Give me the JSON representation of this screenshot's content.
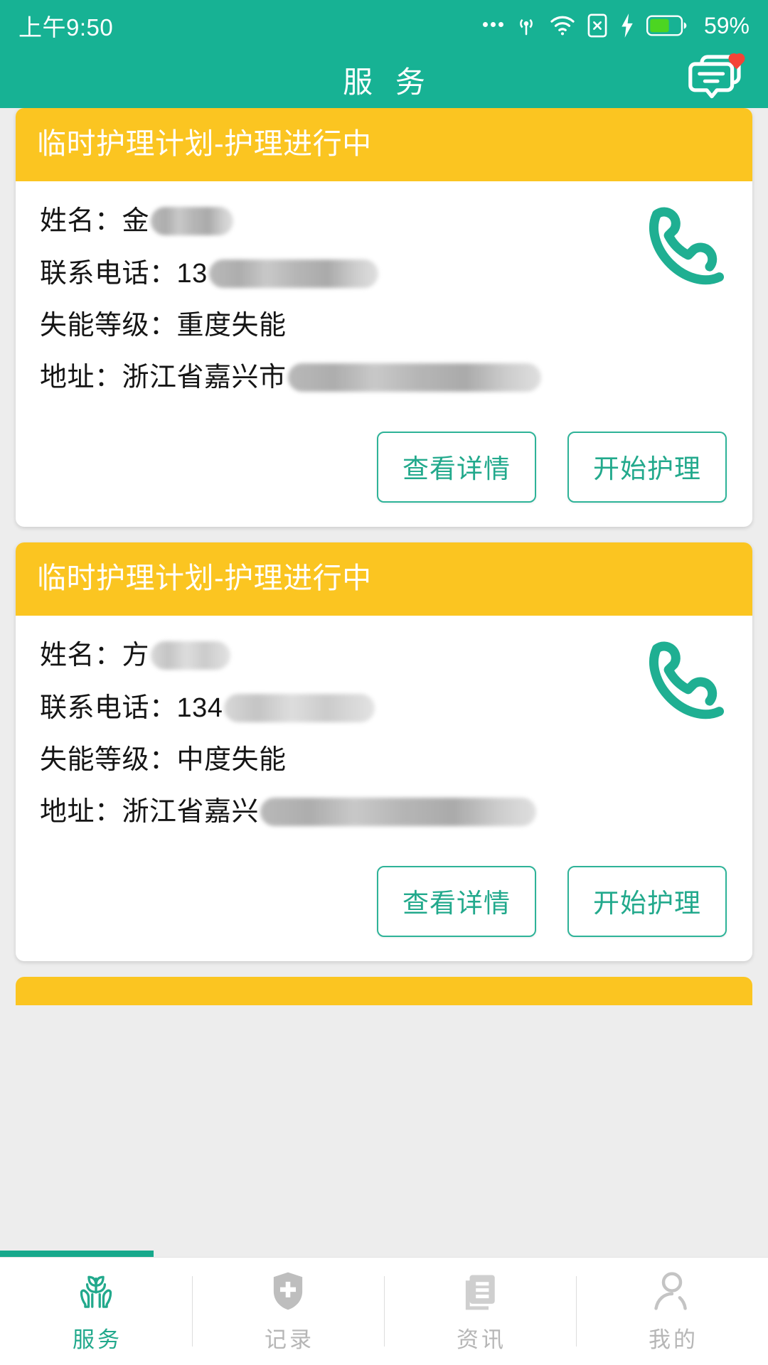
{
  "status_bar": {
    "time": "上午9:50",
    "battery_percent": "59%",
    "icons": [
      "more-dots-icon",
      "location-icon",
      "wifi-icon",
      "sim-card-disabled-icon",
      "charging-bolt-icon",
      "battery-icon"
    ],
    "background_color": "#17B294",
    "text_color": "#FFFFFF"
  },
  "app_bar": {
    "title": "服 务",
    "message_icon": "chat-bubbles-icon",
    "badge_icon": "heart-badge-icon",
    "badge_color": "#F44336",
    "background_color": "#17B294"
  },
  "theme": {
    "accent": "#17B294",
    "card_header": "#FBC521",
    "button_border": "#2EB398",
    "button_text": "#22A98C",
    "page_background": "#EDEDED"
  },
  "labels": {
    "name": "姓名：",
    "phone": "联系电话：",
    "level": "失能等级：",
    "address": "地址："
  },
  "cards": [
    {
      "header": "临时护理计划-护理进行中",
      "name_value": "金",
      "phone_value": "13",
      "level_value": "重度失能",
      "address_value": "浙江省嘉兴市",
      "phone_icon": "phone-handset-icon",
      "buttons": [
        {
          "label": "查看详情",
          "name": "view-details-button"
        },
        {
          "label": "开始护理",
          "name": "start-care-button"
        }
      ]
    },
    {
      "header": "临时护理计划-护理进行中",
      "name_value": "方",
      "phone_value": "134",
      "level_value": "中度失能",
      "address_value": "浙江省嘉兴",
      "phone_icon": "phone-handset-icon",
      "buttons": [
        {
          "label": "查看详情",
          "name": "view-details-button"
        },
        {
          "label": "开始护理",
          "name": "start-care-button"
        }
      ]
    }
  ],
  "tab_bar": {
    "active_index": 0,
    "items": [
      {
        "label": "服务",
        "icon": "plant-in-hands-icon"
      },
      {
        "label": "记录",
        "icon": "shield-plus-icon"
      },
      {
        "label": "资讯",
        "icon": "news-document-icon"
      },
      {
        "label": "我的",
        "icon": "person-icon"
      }
    ]
  }
}
